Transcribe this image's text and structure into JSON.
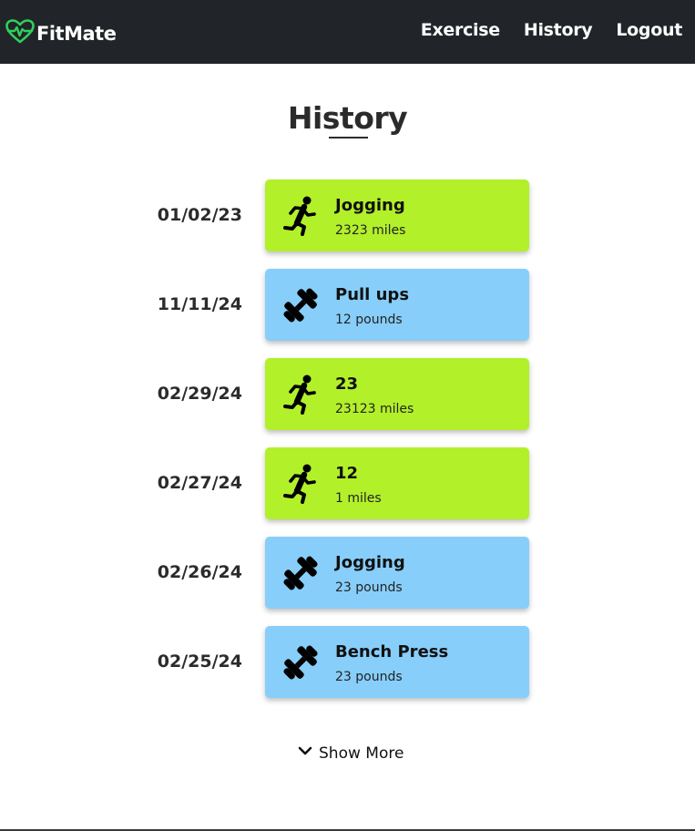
{
  "app": {
    "brand_name": "FitMate",
    "brand_icon": "heart-pulse-icon",
    "brand_icon_color": "#2fd05a"
  },
  "nav": {
    "items": [
      {
        "label": "Exercise"
      },
      {
        "label": "History"
      },
      {
        "label": "Logout"
      }
    ]
  },
  "page": {
    "title": "History"
  },
  "colors": {
    "navbar_bg": "#212529",
    "cardio_card": "#b2f02a",
    "strength_card": "#87cefa"
  },
  "history": {
    "entries": [
      {
        "date": "01/02/23",
        "name": "Jogging",
        "detail": "2323 miles",
        "type": "cardio",
        "icon": "running-person-icon"
      },
      {
        "date": "11/11/24",
        "name": "Pull ups",
        "detail": "12 pounds",
        "type": "strength",
        "icon": "dumbbell-icon"
      },
      {
        "date": "02/29/24",
        "name": "23",
        "detail": "23123 miles",
        "type": "cardio",
        "icon": "running-person-icon"
      },
      {
        "date": "02/27/24",
        "name": "12",
        "detail": "1 miles",
        "type": "cardio",
        "icon": "running-person-icon"
      },
      {
        "date": "02/26/24",
        "name": "Jogging",
        "detail": "23 pounds",
        "type": "strength",
        "icon": "dumbbell-icon"
      },
      {
        "date": "02/25/24",
        "name": "Bench Press",
        "detail": "23 pounds",
        "type": "strength",
        "icon": "dumbbell-icon"
      }
    ]
  },
  "show_more": {
    "label": "Show More",
    "icon": "chevron-down-icon"
  }
}
